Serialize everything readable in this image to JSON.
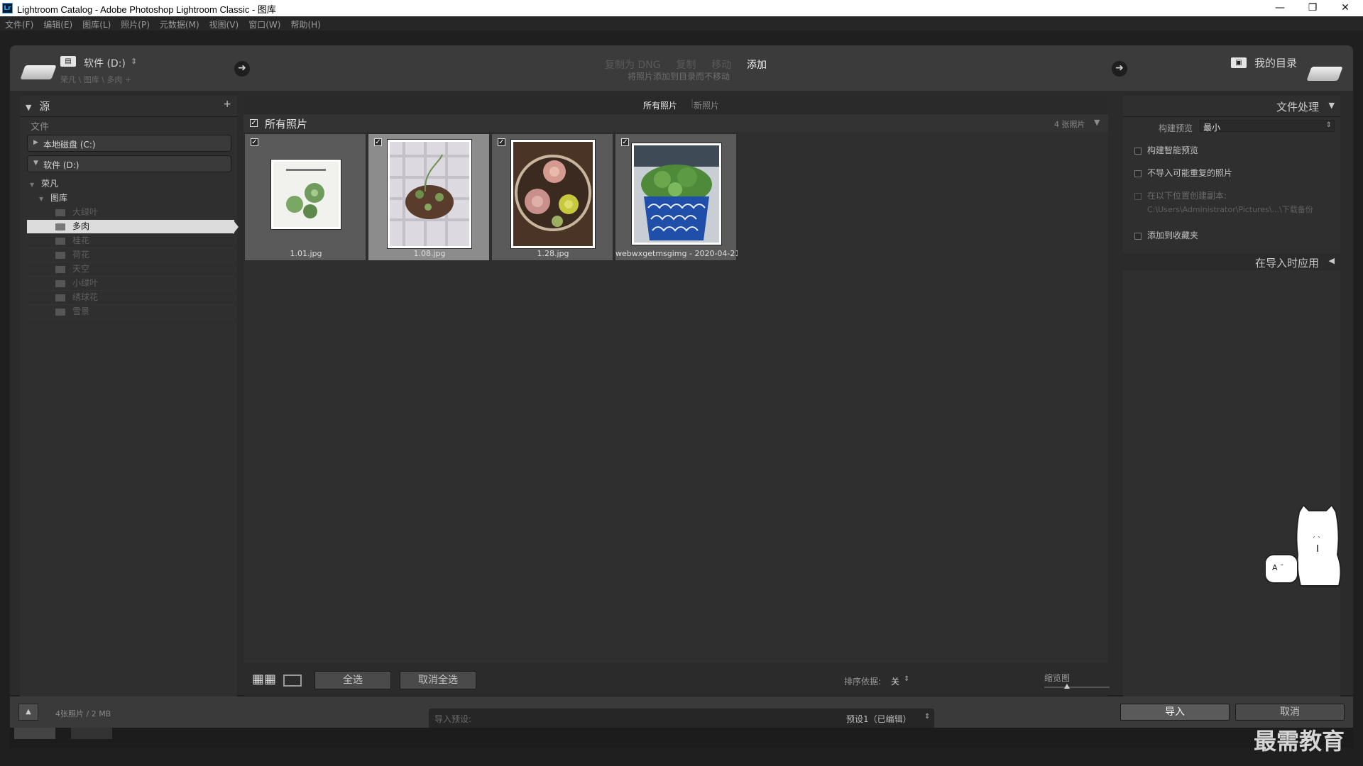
{
  "window": {
    "app_icon": "Lr",
    "title": "Lightroom Catalog - Adobe Photoshop Lightroom Classic - 图库",
    "controls": [
      "minimize-icon",
      "restore-icon",
      "close-icon"
    ]
  },
  "menu": [
    "文件(F)",
    "编辑(E)",
    "图库(L)",
    "照片(P)",
    "元数据(M)",
    "视图(V)",
    "窗口(W)",
    "帮助(H)"
  ],
  "topbar": {
    "source_label": "软件 (D:)",
    "source_path": "荣凡 \\ 图库 \\ 多肉 +",
    "modes": [
      "复制为 DNG",
      "复制",
      "移动",
      "添加"
    ],
    "active_mode": "添加",
    "mode_description": "将照片添加到目录而不移动",
    "destination_label": "我的目录"
  },
  "source_panel": {
    "title": "源",
    "section_label": "文件",
    "drives": [
      {
        "label": "本地磁盘 (C:)",
        "expanded": false
      },
      {
        "label": "软件 (D:)",
        "expanded": true
      }
    ],
    "tree_root": "荣凡",
    "tree_folder": "图库",
    "folders": [
      "大绿叶",
      "多肉",
      "桂花",
      "荷花",
      "天空",
      "小绿叶",
      "绣球花",
      "雪景"
    ],
    "selected_folder": "多肉"
  },
  "grid": {
    "tabs": [
      "所有照片",
      "新照片"
    ],
    "active_tab": "所有照片",
    "header_label": "所有照片",
    "count_label": "4 张照片",
    "photos": [
      {
        "name": "1.01.jpg",
        "checked": true,
        "selected": false
      },
      {
        "name": "1.08.jpg",
        "checked": true,
        "selected": true
      },
      {
        "name": "1.28.jpg",
        "checked": true,
        "selected": false
      },
      {
        "name": "webwxgetmsgimg - 2020-04-21T...",
        "checked": true,
        "selected": false
      }
    ]
  },
  "toolbar": {
    "select_all": "全选",
    "deselect_all": "取消全选",
    "sort_label": "排序依据:",
    "sort_value": "关",
    "thumb_label": "缩览图",
    "thumb_level": 0.35
  },
  "right_panel": {
    "title": "文件处理",
    "build_preview_label": "构建预览",
    "build_preview_value": "最小",
    "options": [
      "构建智能预览",
      "不导入可能重复的照片",
      "在以下位置创建副本:",
      "添加到收藏夹"
    ],
    "copy_path": "C:\\Users\\Administrator\\Pictures\\...\\下载备份",
    "apply_section": "在导入时应用"
  },
  "bottom": {
    "status": "4张照片 / 2 MB",
    "preset_label": "导入预设:",
    "preset_value": "预设1（已编辑）",
    "import_button": "导入",
    "cancel_button": "取消"
  },
  "watermark": "最需教育",
  "colors": {
    "background": "#2b2b2b",
    "panel": "#2f2f2f",
    "selected_row": "#d9d9d9",
    "accent": "#ffffff"
  }
}
